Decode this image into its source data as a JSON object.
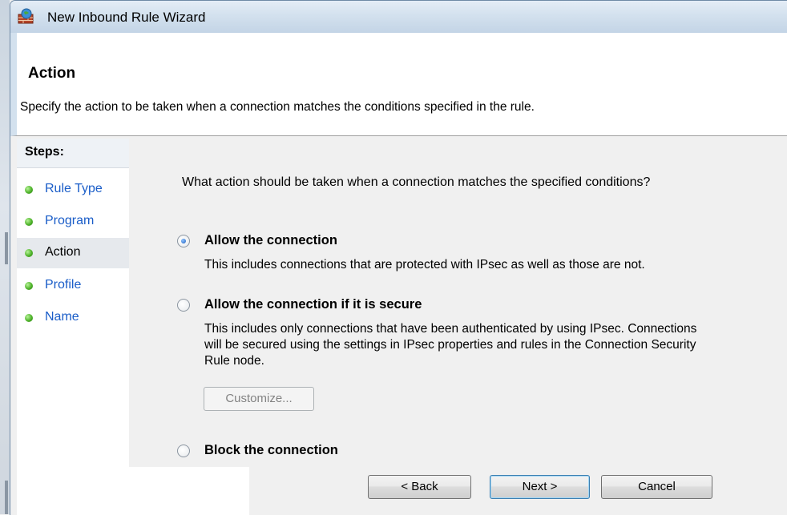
{
  "window": {
    "title": "New Inbound Rule Wizard"
  },
  "header": {
    "title": "Action",
    "description": "Specify the action to be taken when a connection matches the conditions specified in the rule."
  },
  "steps": {
    "heading": "Steps:",
    "items": [
      {
        "label": "Rule Type"
      },
      {
        "label": "Program"
      },
      {
        "label": "Action"
      },
      {
        "label": "Profile"
      },
      {
        "label": "Name"
      }
    ],
    "current": "Action"
  },
  "main": {
    "question": "What action should be taken when a connection matches the specified conditions?",
    "options": [
      {
        "label": "Allow the connection",
        "description": [
          "This includes connections that are protected with IPsec as well as those are not."
        ],
        "selected": true
      },
      {
        "label": "Allow the connection if it is secure",
        "description": [
          "This includes only connections that have been authenticated by using IPsec.  Connections",
          "will be secured using the settings in IPsec properties and rules in the Connection Security",
          "Rule node."
        ],
        "selected": false
      },
      {
        "label": "Block the connection",
        "description": [],
        "selected": false
      }
    ],
    "customize_label": "Customize..."
  },
  "footer": {
    "back_label": "< Back",
    "next_label": "Next >",
    "cancel_label": "Cancel"
  },
  "colors": {
    "link_blue": "#1a5dc8",
    "step_dot_green": "#4fb32b",
    "titlebar": "#d3e1ee"
  }
}
